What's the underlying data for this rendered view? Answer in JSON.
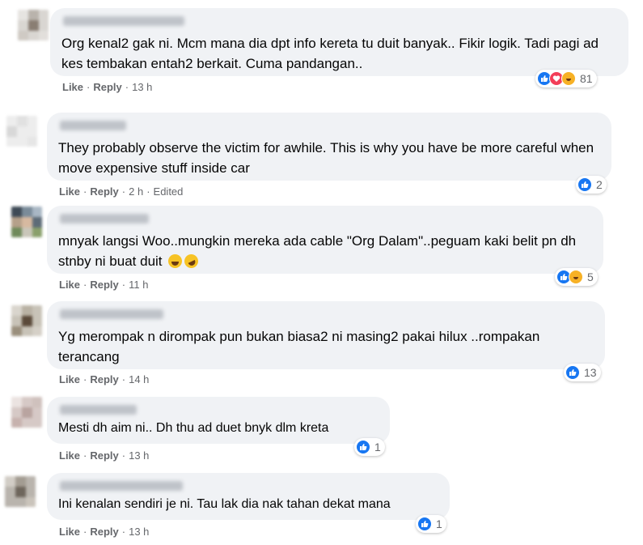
{
  "actions": {
    "like": "Like",
    "reply": "Reply",
    "separator": "·"
  },
  "colors": {
    "like": "#1877f2",
    "love": "#f33e58",
    "haha": "#f7b125",
    "bubble": "#f0f2f5",
    "meta": "#65676b"
  },
  "comments": [
    {
      "text": "Org kenal2 gak ni. Mcm mana dia dpt info kereta tu duit banyak.. Fikir logik. Tadi pagi ad kes tembakan entah2 berkait. Cuma pandangan..",
      "time": "13 h",
      "edited": "",
      "reaction_icons": [
        "like-icon",
        "love-icon",
        "haha-icon"
      ],
      "reaction_count": "81"
    },
    {
      "text": "They probably observe the victim for awhile. This is why you have be more careful when move expensive stuff inside car",
      "time": "2 h",
      "edited": "Edited",
      "reaction_icons": [
        "like-icon"
      ],
      "reaction_count": "2"
    },
    {
      "text": "mnyak langsi Woo..mungkin mereka ada cable \"Org Dalam\"..peguam kaki belit pn dh stnby ni buat duit",
      "time": "11 h",
      "edited": "",
      "reaction_icons": [
        "like-icon",
        "haha-icon"
      ],
      "reaction_count": "5"
    },
    {
      "text": "Yg merompak n dirompak pun bukan biasa2 ni masing2 pakai hilux ..rompakan terancang",
      "time": "14 h",
      "edited": "",
      "reaction_icons": [
        "like-icon"
      ],
      "reaction_count": "13"
    },
    {
      "text": "Mesti dh aim ni.. Dh thu ad duet bnyk dlm kreta",
      "time": "13 h",
      "edited": "",
      "reaction_icons": [
        "like-icon"
      ],
      "reaction_count": "1"
    },
    {
      "text": "Ini kenalan sendiri je ni. Tau lak dia nak tahan dekat mana",
      "time": "13 h",
      "edited": "",
      "reaction_icons": [
        "like-icon"
      ],
      "reaction_count": "1"
    }
  ]
}
